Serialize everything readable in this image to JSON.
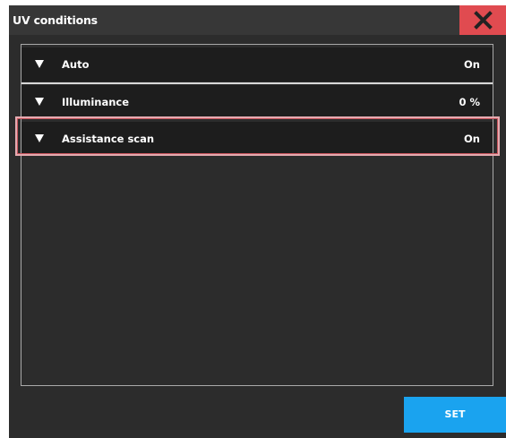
{
  "dialog": {
    "title": "UV conditions",
    "close_icon": "close-x-icon"
  },
  "rows": [
    {
      "label": "Auto",
      "value": "On",
      "icon": "triangle-down-icon"
    },
    {
      "label": "Illuminance",
      "value": "0 %",
      "icon": "triangle-down-icon"
    },
    {
      "label": "Assistance scan",
      "value": "On",
      "icon": "triangle-down-icon",
      "highlighted": true
    }
  ],
  "footer": {
    "set_label": "SET"
  },
  "colors": {
    "dialog_bg": "#2c2c2c",
    "titlebar_bg": "#373737",
    "row_bg": "#1d1d1d",
    "close_bg": "#e04b50",
    "accent": "#1aa3ef",
    "highlight": "#c6545c"
  }
}
